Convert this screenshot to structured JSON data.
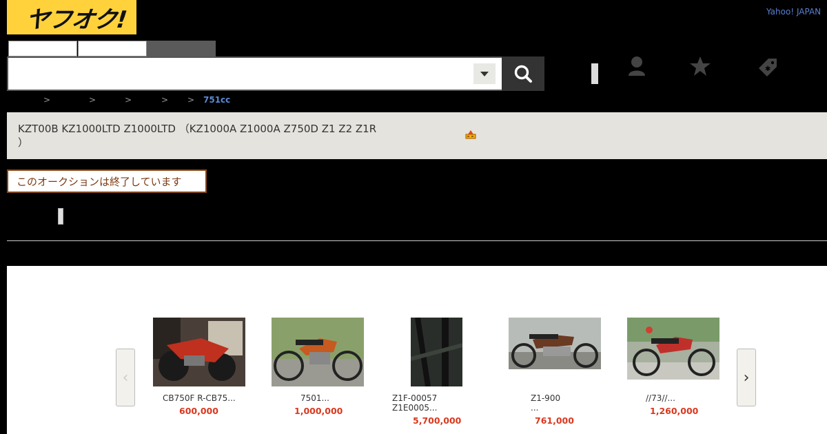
{
  "header": {
    "logo_text": "ヤフオク!",
    "yahoo_link": "Yahoo! JAPAN",
    "search": {
      "value": "",
      "placeholder": ""
    }
  },
  "icons": {
    "search": "search-icon",
    "user": "user-icon",
    "watchlist": "star-icon",
    "coupon": "tag-icon",
    "dropdown": "chevron-down-icon"
  },
  "breadcrumb": {
    "separators": [
      ">",
      ">",
      ">",
      ">",
      ">"
    ],
    "last": "751cc"
  },
  "auction": {
    "title_line1": "KZT00B KZ1000LTD Z1000LTD （KZ1000A Z1000A Z750D Z1 Z2 Z1R",
    "title_line2": "）",
    "ended_notice": "このオークションは終了しています"
  },
  "recommendations": {
    "prev_label": "‹",
    "next_label": "›",
    "items": [
      {
        "title": "CB750F R-CB75...",
        "title2": "",
        "price": "600,000"
      },
      {
        "title": "7501...",
        "title2": "",
        "price": "1,000,000"
      },
      {
        "title": "Z1F-00057",
        "title2": "Z1E0005...",
        "price": "5,700,000"
      },
      {
        "title": "Z1-900",
        "title2": "...",
        "price": "761,000"
      },
      {
        "title": "//73//...",
        "title2": "",
        "price": "1,260,000"
      }
    ]
  },
  "colors": {
    "logo_bg": "#ffd23c",
    "price": "#d9381e",
    "link": "#5a7fd0",
    "title_bar": "#e4e3dd",
    "ended_border": "#8a4a1c"
  }
}
